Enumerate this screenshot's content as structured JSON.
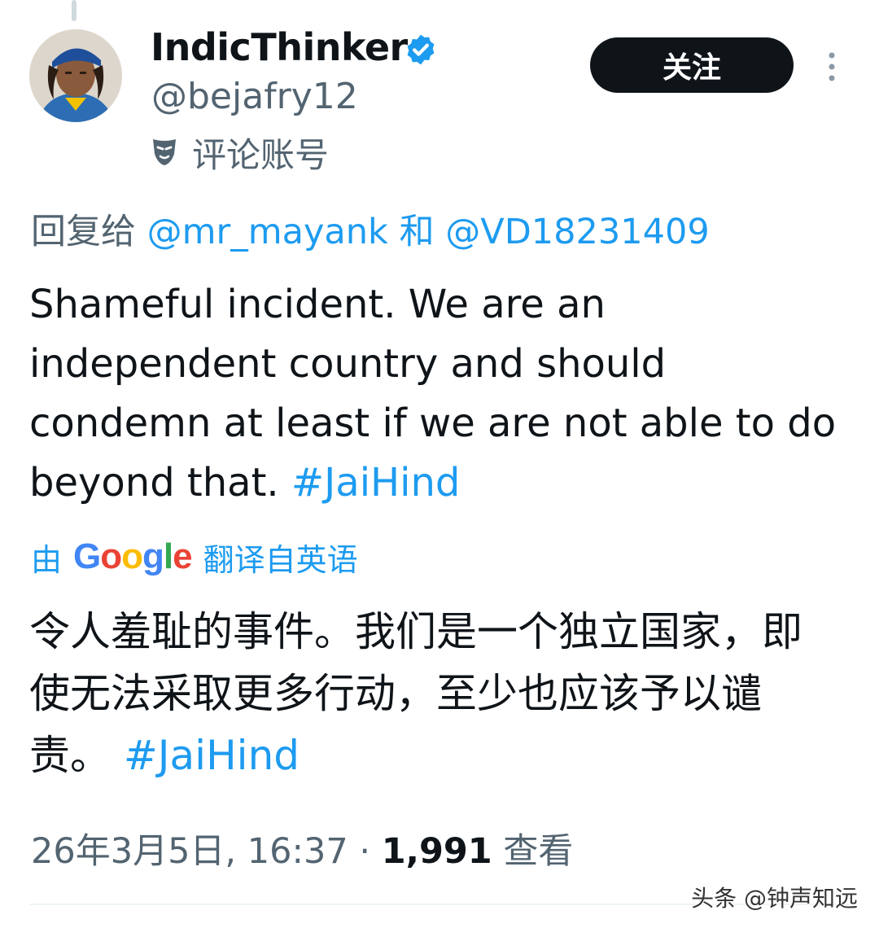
{
  "author": {
    "display_name": "IndicThinker",
    "handle": "@bejafry12",
    "account_label": "评论账号",
    "verified": true
  },
  "actions": {
    "follow_label": "关注",
    "more_icon": "more-vertical-icon"
  },
  "reply": {
    "prefix": "回复给",
    "user1": "@mr_mayank",
    "conjunction": "和",
    "user2": "@VD18231409"
  },
  "tweet": {
    "text": "Shameful incident. We are an independent country and should condemn at least if we are not able to do beyond that.",
    "hashtag": "#JaiHind"
  },
  "translation": {
    "prefix": "由",
    "provider": "Google",
    "suffix": "翻译自英语",
    "text": "令人羞耻的事件。我们是一个独立国家，即使无法采取更多行动，至少也应该予以谴责。",
    "hashtag": "#JaiHind"
  },
  "meta": {
    "timestamp": "26年3月5日, 16:37",
    "separator": "·",
    "views_count": "1,991",
    "views_label": "查看"
  },
  "watermark": "头条 @钟声知远",
  "colors": {
    "link": "#1d9bf0",
    "secondary_text": "#536471",
    "primary_text": "#0f1419",
    "verified_badge": "#1d9bf0",
    "follow_button_bg": "#0f1419"
  }
}
